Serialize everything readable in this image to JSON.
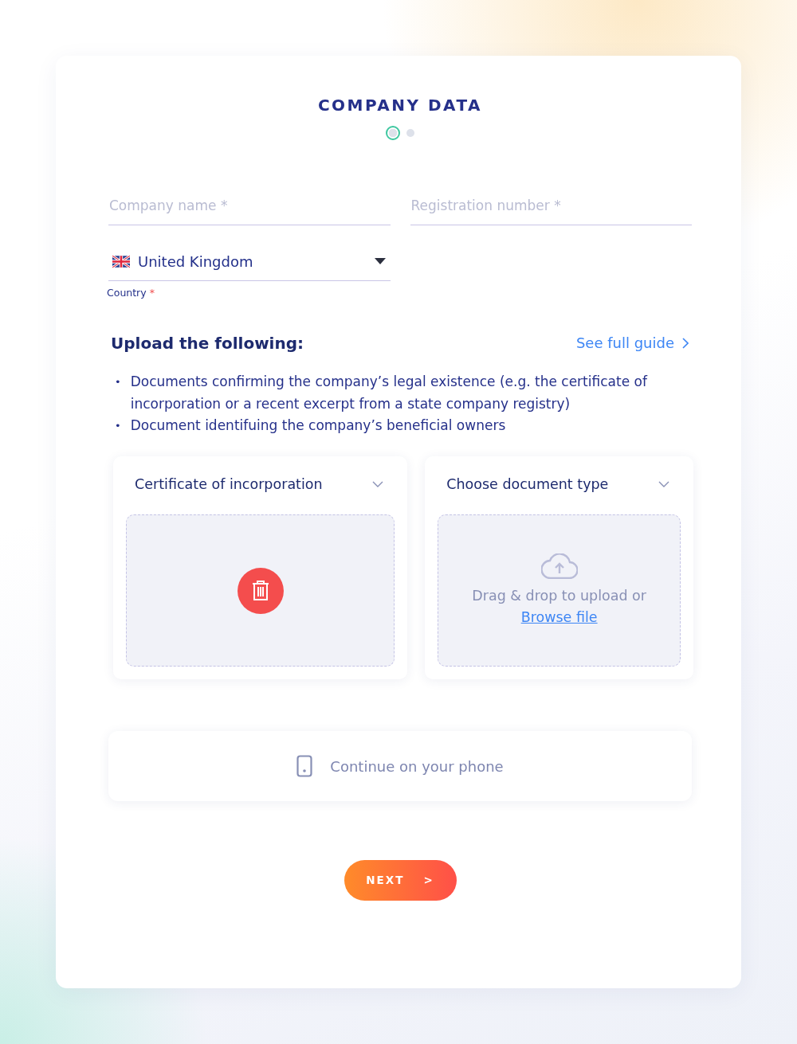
{
  "title": "COMPANY DATA",
  "steps": [
    {
      "selected": true
    },
    {
      "selected": false
    }
  ],
  "fields": [
    {
      "placeholder": "Company name *"
    },
    {
      "placeholder": "Registration number *"
    }
  ],
  "country": {
    "value": "United Kingdom",
    "label": "Country",
    "required_mark": "*"
  },
  "upload": {
    "heading": "Upload the following:",
    "guide_link": "See full guide",
    "items": [
      {
        "marker": "•",
        "text": "Documents confirming the company’s legal existence (e.g. the certificate of incorporation or a recent excerpt from a state company registry)"
      },
      {
        "marker": "•",
        "text": "Document identifuing the company’s beneficial owners"
      }
    ]
  },
  "slots": [
    {
      "kind": "uploaded",
      "document_type": "Certificate of incorporation"
    },
    {
      "kind": "empty",
      "document_type": "Choose document type",
      "hint": "Drag & drop to upload or",
      "browse_link": "Browse file"
    }
  ],
  "phone_button": "Continue on your phone",
  "next_button": {
    "label": "NEXT",
    "arrow": ">"
  }
}
